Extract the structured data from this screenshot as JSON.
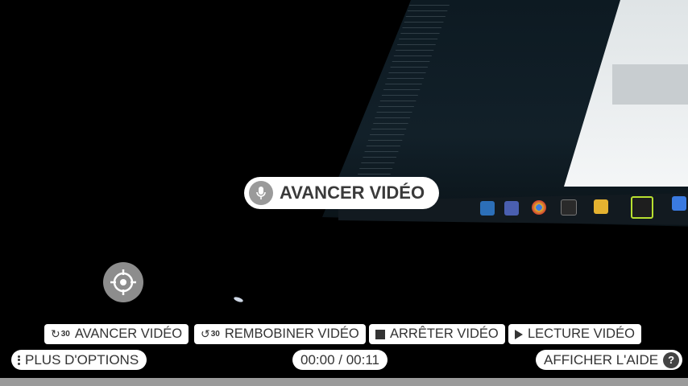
{
  "voice_command": {
    "label": "AVANCER VIDÉO",
    "icon": "microphone-icon"
  },
  "crosshair": {
    "icon": "crosshair-icon"
  },
  "commands": [
    {
      "label": "AVANCER VIDÉO",
      "icon": "forward-30-icon",
      "icon_number": "30"
    },
    {
      "label": "REMBOBINER VIDÉO",
      "icon": "rewind-30-icon",
      "icon_number": "30"
    },
    {
      "label": "ARRÊTER VIDÉO",
      "icon": "stop-icon"
    },
    {
      "label": "LECTURE VIDÉO",
      "icon": "play-icon"
    }
  ],
  "more_options": {
    "label": "PLUS D'OPTIONS",
    "icon": "kebab-menu-icon"
  },
  "time": {
    "current": "00:00",
    "total": "00:11",
    "display": "00:00 / 00:11"
  },
  "help": {
    "label": "AFFICHER L'AIDE",
    "icon": "help-icon",
    "glyph": "?"
  },
  "colors": {
    "pill_bg": "#ffffff",
    "pill_text": "#333333",
    "icon_gray": "#9a9a9a",
    "background": "#000000"
  }
}
